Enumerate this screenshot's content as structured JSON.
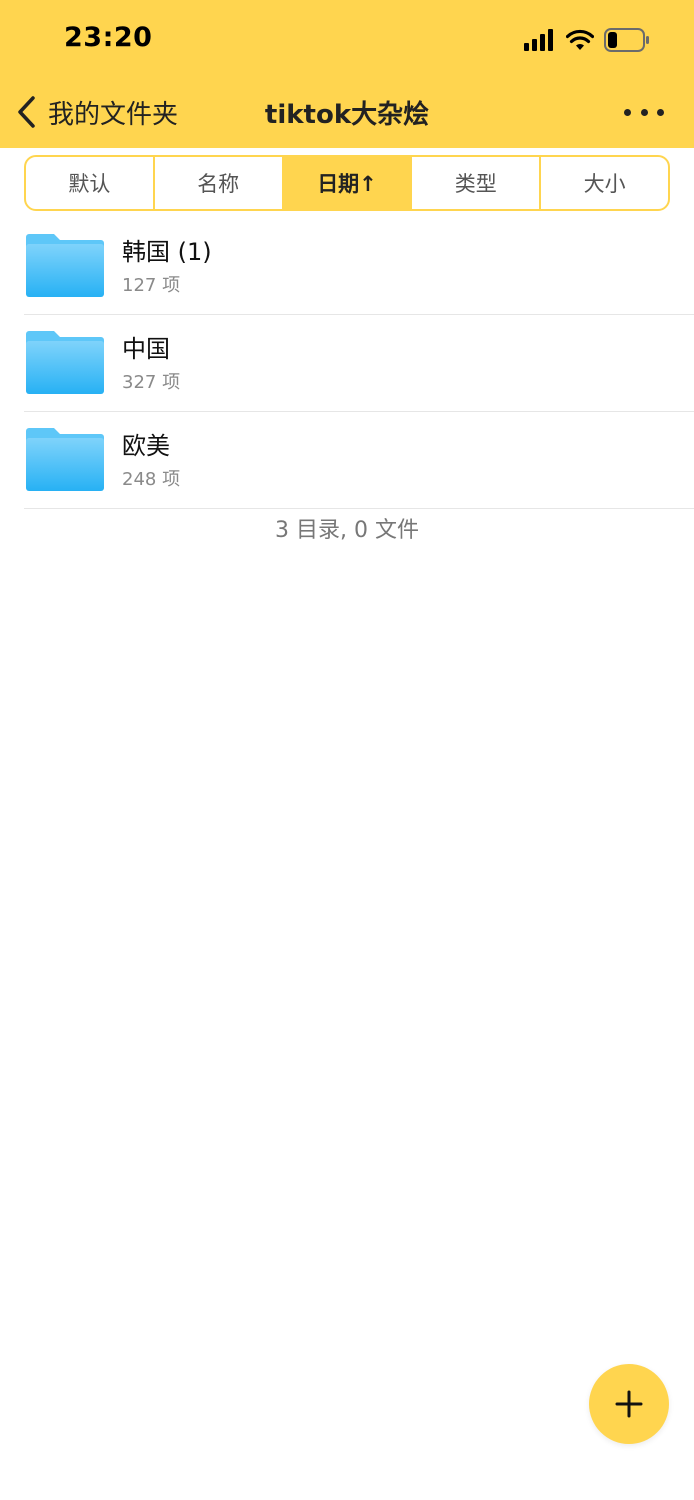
{
  "colors": {
    "accent": "#FFD54F",
    "folder_blue": "#3BB9F6",
    "text_primary": "#111111",
    "text_secondary": "#8a8a8a"
  },
  "status_bar": {
    "time": "23:20",
    "icons": [
      "signal-icon",
      "wifi-icon",
      "battery-low-icon"
    ]
  },
  "nav": {
    "back_label": "我的文件夹",
    "title": "tiktok大杂烩",
    "more_icon": "more-horizontal-icon"
  },
  "sort_tabs": [
    {
      "label": "默认",
      "active": false
    },
    {
      "label": "名称",
      "active": false
    },
    {
      "label": "日期↑",
      "active": true
    },
    {
      "label": "类型",
      "active": false
    },
    {
      "label": "大小",
      "active": false
    }
  ],
  "folders": [
    {
      "name": "韩国 (1)",
      "count": "127 项",
      "icon": "folder-icon"
    },
    {
      "name": "中国",
      "count": "327 项",
      "icon": "folder-icon"
    },
    {
      "name": "欧美",
      "count": "248 项",
      "icon": "folder-icon"
    }
  ],
  "summary": "3 目录, 0 文件",
  "fab": {
    "icon": "plus-icon"
  }
}
